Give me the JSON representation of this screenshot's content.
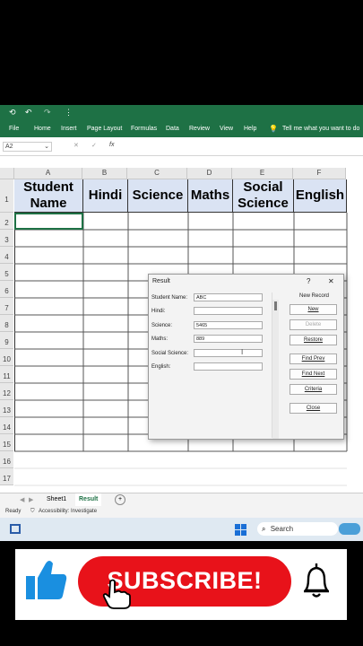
{
  "titlebar": {
    "undo": "↶",
    "redo": "↷",
    "more": "⋮"
  },
  "menu": [
    "File",
    "Home",
    "Insert",
    "Page Layout",
    "Formulas",
    "Data",
    "Review",
    "View",
    "Help"
  ],
  "tell_me": "Tell me what you want to do",
  "formula_bar": {
    "namebox": "A2",
    "cancel": "✕",
    "enter": "✓",
    "fx": "fx"
  },
  "columns": [
    "A",
    "B",
    "C",
    "D",
    "E",
    "F"
  ],
  "rows": [
    "1",
    "2",
    "3",
    "4",
    "5",
    "6",
    "7",
    "8",
    "9",
    "10",
    "11",
    "12",
    "13",
    "14",
    "15",
    "16",
    "17"
  ],
  "headers": [
    "Student Name",
    "Hindi",
    "Science",
    "Maths",
    "Social Science",
    "English"
  ],
  "sheets": {
    "sheet1": "Sheet1",
    "result": "Result",
    "add": "+"
  },
  "status": {
    "ready": "Ready",
    "accessibility": "Accessibility: Investigate"
  },
  "taskbar": {
    "search": "Search"
  },
  "dialog": {
    "title": "Result",
    "help": "?",
    "close": "✕",
    "record_label": "New Record",
    "fields": [
      {
        "label": "Student Name:",
        "value": "ABC"
      },
      {
        "label": "Hindi:",
        "value": ""
      },
      {
        "label": "Science:",
        "value": "5465"
      },
      {
        "label": "Maths:",
        "value": "889"
      },
      {
        "label": "Social Science:",
        "value": ""
      },
      {
        "label": "English:",
        "value": ""
      }
    ],
    "buttons": [
      "New",
      "Delete",
      "Restore",
      "Find Prev",
      "Find Next",
      "Criteria",
      "Close"
    ]
  },
  "banner": {
    "subscribe": "SUBSCRIBE!"
  },
  "colors": {
    "excel_green": "#1e7145",
    "header_fill": "#dae3f3",
    "subscribe_red": "#e8121a",
    "thumb_blue": "#1a8fe0"
  }
}
